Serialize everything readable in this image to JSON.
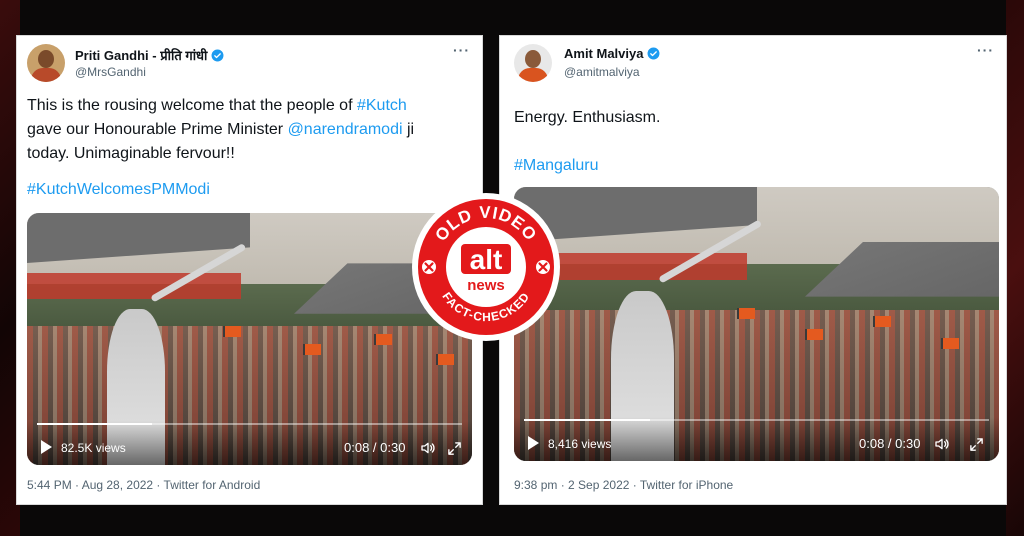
{
  "tweet_left": {
    "name": "Priti Gandhi - प्रीति गांधी",
    "handle": "@MrsGandhi",
    "text_line1_pre": "This is the rousing welcome that the people of ",
    "tag_kutch": "#Kutch",
    "text_line2_pre": "gave our Honourable Prime Minister ",
    "mention": "@narendramodi",
    "text_line2_post": " ji",
    "text_line3": "today. Unimaginable fervour!!",
    "hashtag": "#KutchWelcomesPMModi",
    "views": "82.5K views",
    "time": "0:08 / 0:30",
    "footer": "5:44 PM · Aug 28, 2022 · Twitter for Android",
    "progress": 0.27
  },
  "tweet_right": {
    "name": "Amit Malviya",
    "handle": "@amitmalviya",
    "text": "Energy. Enthusiasm.",
    "hashtag": "#Mangaluru",
    "views": "8,416 views",
    "time": "0:08 / 0:30",
    "footer": "9:38 pm · 2 Sep 2022 · Twitter for iPhone",
    "progress": 0.27
  },
  "badge": {
    "top_text": "OLD VIDEO",
    "logo_top": "alt",
    "logo_bottom": "news",
    "bottom_text": "FACT-CHECKED"
  },
  "icons": {
    "more": "more-icon",
    "verified": "verified-icon",
    "play": "play-icon",
    "volume": "volume-icon",
    "fullscreen": "fullscreen-icon"
  },
  "colors": {
    "link": "#1d9bf0",
    "verified": "#1d9bf0",
    "badge_red": "#e3191b",
    "text": "#0f1419",
    "muted": "#536471"
  }
}
